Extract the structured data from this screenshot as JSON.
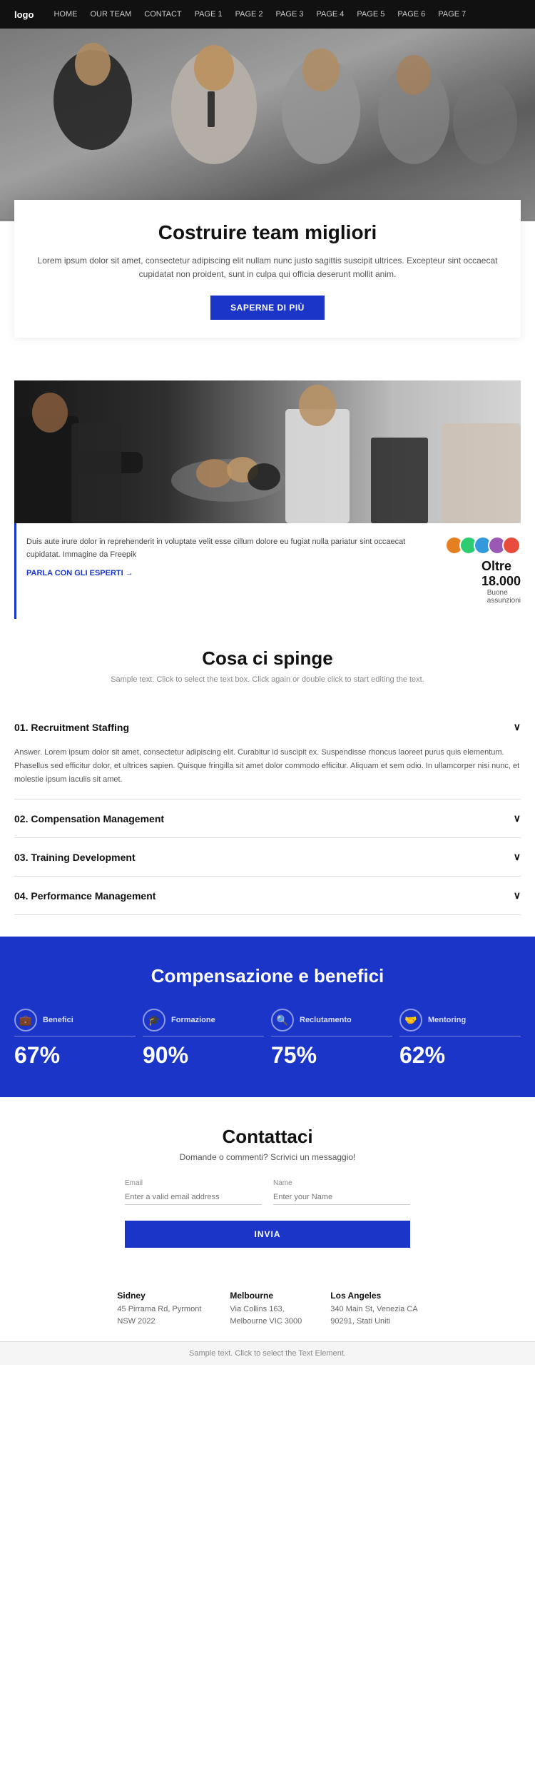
{
  "nav": {
    "logo": "logo",
    "links": [
      {
        "label": "HOME",
        "href": "#"
      },
      {
        "label": "OUR TEAM",
        "href": "#"
      },
      {
        "label": "CONTACT",
        "href": "#"
      },
      {
        "label": "PAGE 1",
        "href": "#"
      },
      {
        "label": "PAGE 2",
        "href": "#"
      },
      {
        "label": "PAGE 3",
        "href": "#"
      },
      {
        "label": "PAGE 4",
        "href": "#"
      },
      {
        "label": "PAGE 5",
        "href": "#"
      },
      {
        "label": "PAGE 6",
        "href": "#"
      },
      {
        "label": "PAGE 7",
        "href": "#"
      }
    ]
  },
  "hero": {
    "title": "Costruire team migliori",
    "description": "Lorem ipsum dolor sit amet, consectetur adipiscing elit nullam nunc justo sagittis suscipit ultrices. Excepteur sint occaecat cupidatat non proident, sunt in culpa qui officia deserunt mollit anim.",
    "cta_label": "SAPERNE DI PIÙ"
  },
  "info": {
    "body": "Duis aute irure dolor in reprehenderit in voluptate velit esse cillum dolore eu fugiat nulla pariatur sint occaecat cupidatat. Immagine da Freepik",
    "link_label": "PARLA CON GLI ESPERTI",
    "stat_number": "Oltre\n18.000",
    "stat_label": "Buone\nassunzioni"
  },
  "cosa": {
    "title": "Cosa ci spinge",
    "subtitle": "Sample text. Click to select the text box. Click again or double click to start editing the text."
  },
  "accordion": [
    {
      "id": "01",
      "title": "01. Recruitment Staffing",
      "open": true,
      "body": "Answer. Lorem ipsum dolor sit amet, consectetur adipiscing elit. Curabitur id suscipit ex. Suspendisse rhoncus laoreet purus quis elementum. Phasellus sed efficitur dolor, et ultrices sapien. Quisque fringilla sit amet dolor commodo efficitur. Aliquam et sem odio. In ullamcorper nisi nunc, et molestie ipsum iaculis sit amet."
    },
    {
      "id": "02",
      "title": "02. Compensation Management",
      "open": false,
      "body": ""
    },
    {
      "id": "03",
      "title": "03. Training Development",
      "open": false,
      "body": ""
    },
    {
      "id": "04",
      "title": "04. Performance Management",
      "open": false,
      "body": ""
    }
  ],
  "compensation": {
    "title": "Compensazione e benefici",
    "items": [
      {
        "icon": "💼",
        "label": "Benefici",
        "percent": "67%"
      },
      {
        "icon": "🎓",
        "label": "Formazione",
        "percent": "90%"
      },
      {
        "icon": "🔍",
        "label": "Reclutamento",
        "percent": "75%"
      },
      {
        "icon": "🤝",
        "label": "Mentoring",
        "percent": "62%"
      }
    ]
  },
  "contact": {
    "title": "Contattaci",
    "subtitle": "Domande o commenti? Scrivici un messaggio!",
    "email_label": "Email",
    "email_placeholder": "Enter a valid email address",
    "name_label": "Name",
    "name_placeholder": "Enter your Name",
    "submit_label": "INVIA"
  },
  "offices": [
    {
      "city": "Sidney",
      "address": "45 Pirrama Rd, Pyrmont\nNSW 2022"
    },
    {
      "city": "Melbourne",
      "address": "Via Collins 163,\nMelbourne VIC 3000"
    },
    {
      "city": "Los Angeles",
      "address": "340 Main St, Venezia CA\n90291, Stati Uniti"
    }
  ],
  "footer": {
    "note": "Sample text. Click to select the Text Element."
  }
}
